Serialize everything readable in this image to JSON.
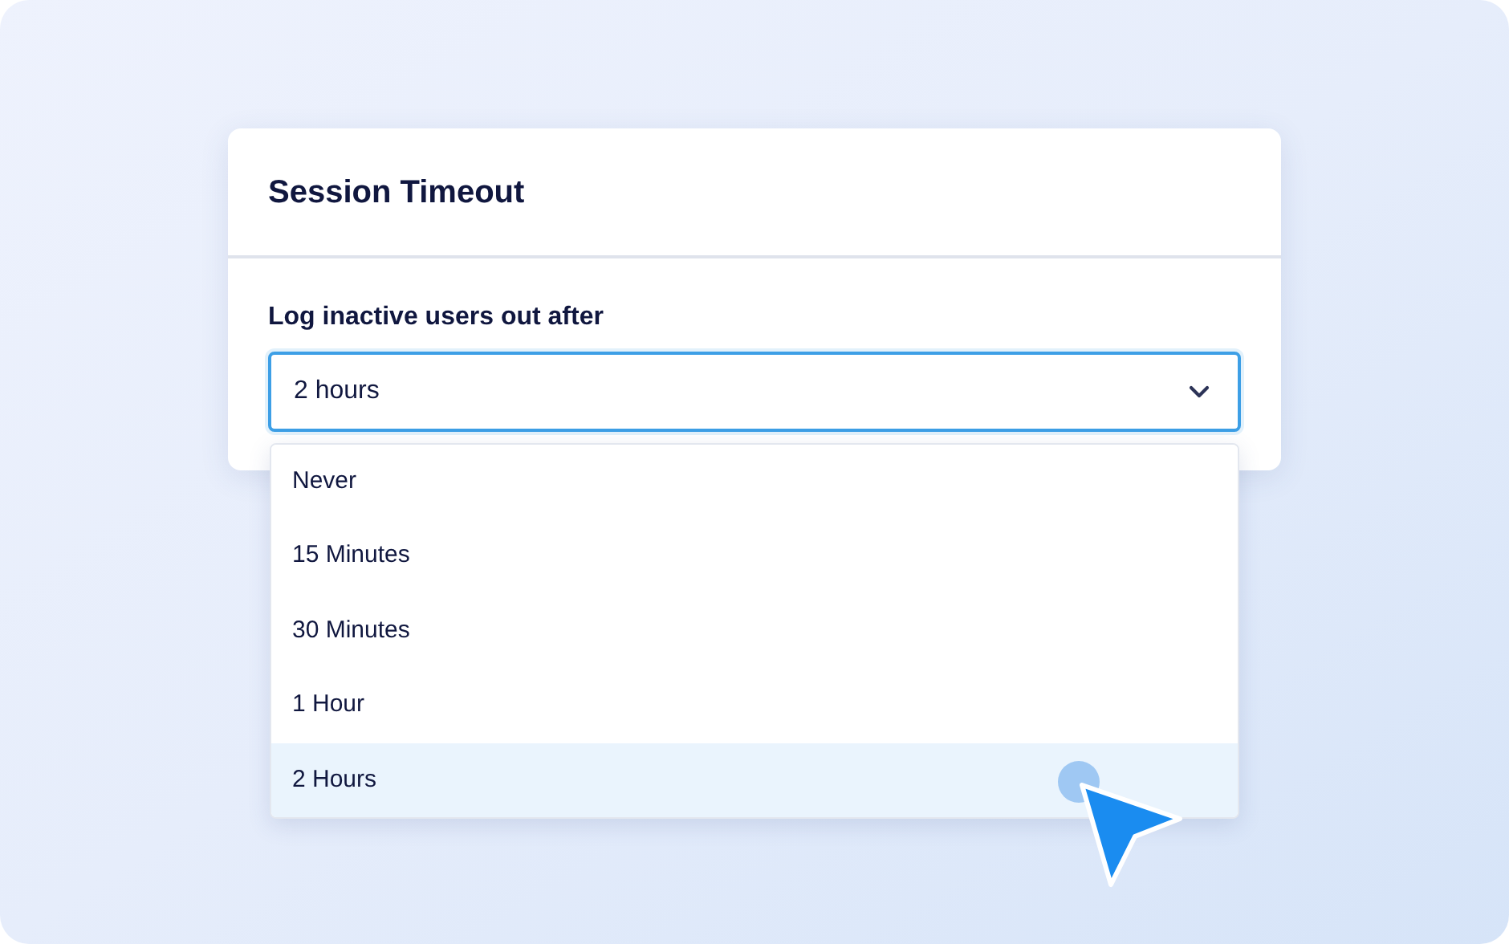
{
  "panel": {
    "title": "Session Timeout"
  },
  "field": {
    "label": "Log inactive users out after",
    "value": "2 hours",
    "expanded": true
  },
  "options": [
    {
      "label": "Never",
      "selected": false
    },
    {
      "label": "15 Minutes",
      "selected": false
    },
    {
      "label": "30 Minutes",
      "selected": false
    },
    {
      "label": "1 Hour",
      "selected": false
    },
    {
      "label": "2 Hours",
      "selected": true
    }
  ]
}
